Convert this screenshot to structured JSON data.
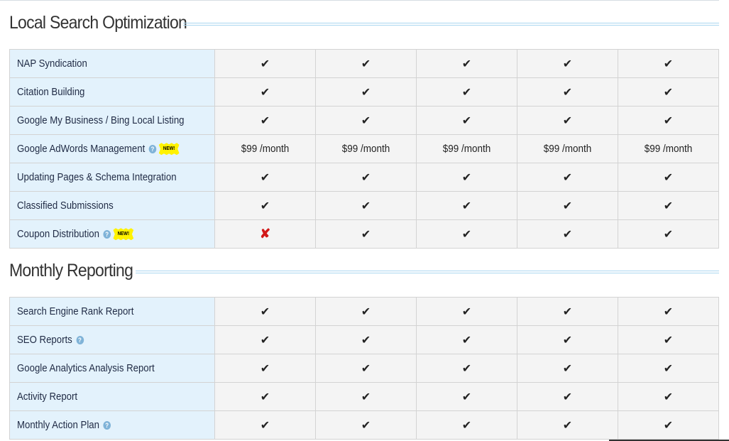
{
  "sections": [
    {
      "title": "Local Search Optimization",
      "rows": [
        {
          "label": "NAP Syndication",
          "help": false,
          "new": false,
          "values": [
            "✔",
            "✔",
            "✔",
            "✔",
            "✔"
          ]
        },
        {
          "label": "Citation Building",
          "help": false,
          "new": false,
          "values": [
            "✔",
            "✔",
            "✔",
            "✔",
            "✔"
          ]
        },
        {
          "label": "Google My Business / Bing Local Listing",
          "help": false,
          "new": false,
          "values": [
            "✔",
            "✔",
            "✔",
            "✔",
            "✔"
          ]
        },
        {
          "label": "Google AdWords Management",
          "help": true,
          "new": true,
          "values": [
            "$99 /month",
            "$99 /month",
            "$99 /month",
            "$99 /month",
            "$99 /month"
          ]
        },
        {
          "label": "Updating Pages & Schema Integration",
          "help": false,
          "new": false,
          "values": [
            "✔",
            "✔",
            "✔",
            "✔",
            "✔"
          ]
        },
        {
          "label": "Classified Submissions",
          "help": false,
          "new": false,
          "values": [
            "✔",
            "✔",
            "✔",
            "✔",
            "✔"
          ]
        },
        {
          "label": "Coupon Distribution",
          "help": true,
          "new": true,
          "values": [
            "✘",
            "✔",
            "✔",
            "✔",
            "✔"
          ]
        }
      ]
    },
    {
      "title": "Monthly Reporting",
      "rows": [
        {
          "label": "Search Engine Rank Report",
          "help": false,
          "new": false,
          "values": [
            "✔",
            "✔",
            "✔",
            "✔",
            "✔"
          ]
        },
        {
          "label": "SEO Reports",
          "help": true,
          "new": false,
          "values": [
            "✔",
            "✔",
            "✔",
            "✔",
            "✔"
          ]
        },
        {
          "label": "Google Analytics Analysis Report",
          "help": false,
          "new": false,
          "values": [
            "✔",
            "✔",
            "✔",
            "✔",
            "✔"
          ]
        },
        {
          "label": "Activity Report",
          "help": false,
          "new": false,
          "values": [
            "✔",
            "✔",
            "✔",
            "✔",
            "✔"
          ]
        },
        {
          "label": "Monthly Action Plan",
          "help": true,
          "new": false,
          "values": [
            "✔",
            "✔",
            "✔",
            "✔",
            "✔"
          ]
        }
      ]
    }
  ],
  "badge_text": "NEW!",
  "help_glyph": "?",
  "icons": {
    "check": "check-icon",
    "cross": "cross-icon",
    "help": "help-icon",
    "new": "new-badge-icon"
  },
  "colors": {
    "label_bg": "#e3f2fc",
    "value_bg": "#f4f4f4",
    "cross": "#d21818",
    "badge": "#fff200",
    "rule": "#a9d6f0"
  }
}
